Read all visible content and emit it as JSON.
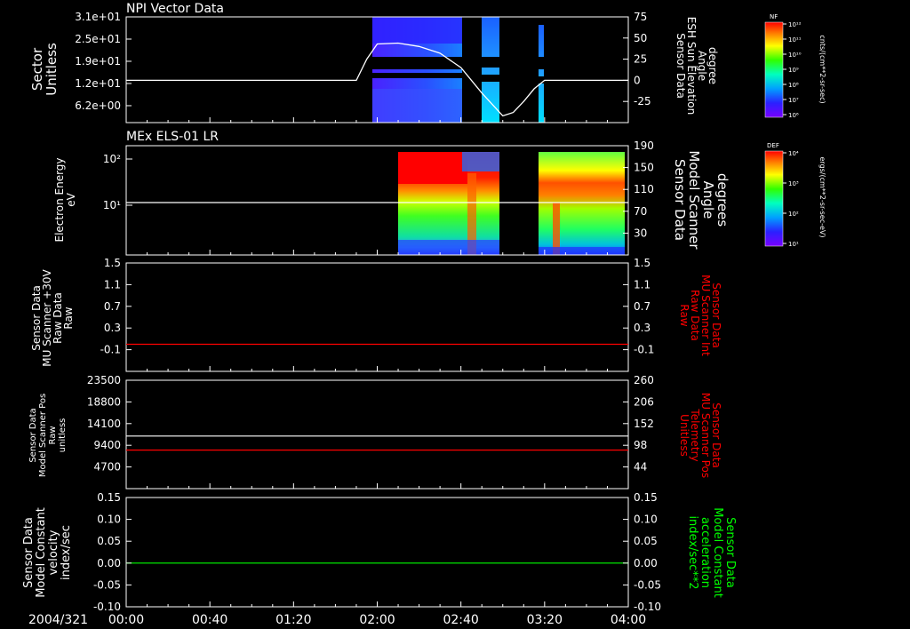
{
  "colors": {
    "background": "#000000",
    "axes": "#ffffff",
    "red_trace": "#ff0000",
    "green_trace": "#00ff00"
  },
  "chart_data": [
    {
      "type": "heatmap",
      "title": "NPI Vector Data",
      "ylabel_left": [
        "Sector",
        "Unitless"
      ],
      "yticks_left": [
        "3.1e+01",
        "2.5e+01",
        "1.9e+01",
        "1.2e+01",
        "6.2e+00"
      ],
      "ylabel_right": [
        "Sensor Data",
        "ESH Sun Elevation",
        "Angle",
        "degree"
      ],
      "yticks_right": [
        "75",
        "50",
        "25",
        "0",
        "-25"
      ],
      "right_ylim": [
        -50,
        75
      ],
      "overlay_series": {
        "name": "ESH Sun Elevation Angle",
        "x": [
          "01:50",
          "01:55",
          "02:00",
          "02:10",
          "02:20",
          "02:30",
          "02:40",
          "02:50",
          "03:00",
          "03:05",
          "03:10",
          "03:15",
          "03:20",
          "03:25",
          "03:30",
          "04:00"
        ],
        "y": [
          0,
          25,
          43,
          44,
          40,
          32,
          15,
          -15,
          -42,
          -38,
          -25,
          -10,
          0,
          0,
          0,
          0
        ]
      },
      "colorbar": {
        "label": "NF",
        "units": "cnts/(cm**2-sr-sec)",
        "ticks": [
          "10^12",
          "10^11",
          "10^10",
          "10^9",
          "10^8",
          "10^7",
          "10^6"
        ]
      }
    },
    {
      "type": "heatmap",
      "title": "MEx ELS-01 LR",
      "ylabel_left": [
        "Electron Energy",
        "eV"
      ],
      "yticks_left": [
        "10^2",
        "10^1"
      ],
      "ylabel_right": [
        "Sensor Data",
        "Model Scanner",
        "Angle",
        "degrees"
      ],
      "yticks_right": [
        "190",
        "150",
        "110",
        "70",
        "30"
      ],
      "right_ylim": [
        -10,
        190
      ],
      "overlay_series": {
        "name": "Model Scanner Angle",
        "x": [
          "00:00",
          "04:00"
        ],
        "y": [
          86,
          86
        ]
      },
      "colorbar": {
        "label": "DEF",
        "units": "ergs/(cm**2-sr-sec-eV)",
        "ticks": [
          "10^4",
          "10^3",
          "10^2",
          "10^1"
        ]
      }
    },
    {
      "type": "line",
      "ylabel_left": [
        "Sensor Data",
        "MU Scanner +30V",
        "Raw Data",
        "Raw"
      ],
      "yticks_left": [
        "1.5",
        "1.1",
        "0.7",
        "0.3",
        "-0.1"
      ],
      "ylabel_right": [
        "Sensor Data",
        "MU Scanner Int",
        "Raw Data",
        "Raw"
      ],
      "yticks_right": [
        "1.5",
        "1.1",
        "0.7",
        "0.3",
        "-0.1"
      ],
      "ylim": [
        -0.5,
        1.5
      ],
      "series": [
        {
          "name": "MU Scanner Int Raw Data",
          "color": "#ff0000",
          "x": [
            "00:00",
            "04:00"
          ],
          "y": [
            0.0,
            0.0
          ]
        }
      ]
    },
    {
      "type": "line",
      "ylabel_left": [
        "Sensor Data",
        "Model Scanner Pos",
        "Raw",
        "unitless"
      ],
      "yticks_left": [
        "23500",
        "18800",
        "14100",
        "9400",
        "4700"
      ],
      "ylabel_right": [
        "Sensor Data",
        "MU Scanner Pos",
        "Telemetry",
        "Unitless"
      ],
      "yticks_right": [
        "260",
        "206",
        "152",
        "98",
        "44"
      ],
      "ylim": [
        0,
        23500
      ],
      "right_ylim": [
        -10,
        260
      ],
      "series": [
        {
          "name": "Model Scanner Pos Raw",
          "color": "#ffffff",
          "x": [
            "00:00",
            "04:00"
          ],
          "y": [
            11400,
            11400
          ]
        },
        {
          "name": "MU Scanner Pos Telemetry",
          "color": "#ff0000",
          "x": [
            "00:00",
            "04:00"
          ],
          "y": [
            86,
            86
          ]
        }
      ]
    },
    {
      "type": "line",
      "ylabel_left": [
        "Sensor Data",
        "Model Constant",
        "velocity",
        "index/sec"
      ],
      "yticks_left": [
        "0.15",
        "0.10",
        "0.05",
        "0.00",
        "-0.05",
        "-0.10"
      ],
      "ylabel_right": [
        "Sensor Data",
        "Model Constant",
        "acceleration",
        "index/sec**2"
      ],
      "yticks_right": [
        "0.15",
        "0.10",
        "0.05",
        "0.00",
        "-0.05",
        "-0.10"
      ],
      "ylim": [
        -0.1,
        0.15
      ],
      "series": [
        {
          "name": "Model Constant acceleration",
          "color": "#00ff00",
          "x": [
            "00:00",
            "04:00"
          ],
          "y": [
            0.0,
            0.0
          ]
        }
      ]
    }
  ],
  "x_axis": {
    "date": "2004/321",
    "ticks": [
      "00:00",
      "00:40",
      "01:20",
      "02:00",
      "02:40",
      "03:20",
      "04:00"
    ]
  }
}
